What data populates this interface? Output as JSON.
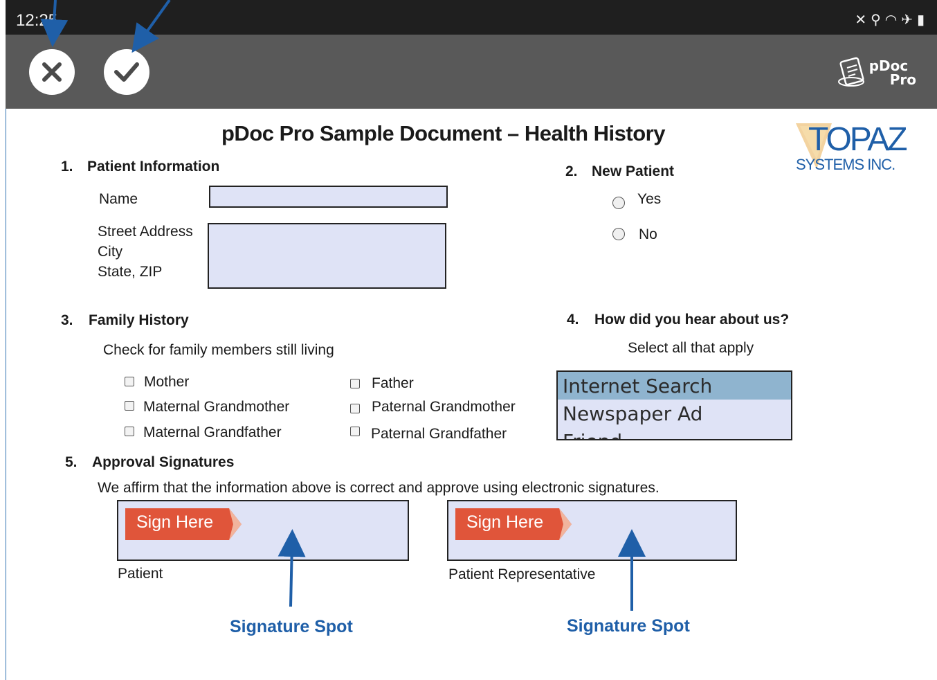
{
  "status_bar": {
    "time": "12:25",
    "icons": [
      "mute-icon",
      "location-icon",
      "wifi-icon",
      "airplane-icon",
      "battery-icon"
    ]
  },
  "toolbar": {
    "cancel_icon": "close-icon",
    "confirm_icon": "check-icon",
    "logo_line1": "pDoc",
    "logo_line2": "Pro"
  },
  "document": {
    "title": "pDoc Pro Sample Document – Health History",
    "brand_logo": {
      "name": "TOPAZ",
      "sub": "SYSTEMS INC."
    },
    "section1": {
      "number": "1.",
      "heading": "Patient Information",
      "name_label": "Name",
      "address_label_1": "Street Address",
      "address_label_2": "City",
      "address_label_3": "State, ZIP",
      "name_value": "",
      "address_value": ""
    },
    "section2": {
      "number": "2.",
      "heading": "New Patient",
      "options": [
        "Yes",
        "No"
      ]
    },
    "section3": {
      "number": "3.",
      "heading": "Family History",
      "instruction": "Check for family members still living",
      "members": [
        "Mother",
        "Maternal Grandmother",
        "Maternal Grandfather",
        "Father",
        "Paternal Grandmother",
        "Paternal Grandfather"
      ]
    },
    "section4": {
      "number": "4.",
      "heading": "How did you hear about us?",
      "instruction": "Select all that apply",
      "options": [
        "Internet Search",
        "Newspaper Ad",
        "Friend"
      ],
      "selected": "Internet Search"
    },
    "section5": {
      "number": "5.",
      "heading": "Approval Signatures",
      "statement": "We affirm that the information above is correct and approve using electronic signatures.",
      "sign_here": "Sign Here",
      "patient_label": "Patient",
      "representative_label": "Patient Representative"
    }
  },
  "annotations": {
    "signature_spot": "Signature Spot"
  },
  "colors": {
    "annotation_blue": "#1f5fa8",
    "field_fill": "#dfe3f6",
    "sign_tag": "#e0553a",
    "list_selected": "#8fb4cf",
    "toolbar": "#595959"
  }
}
